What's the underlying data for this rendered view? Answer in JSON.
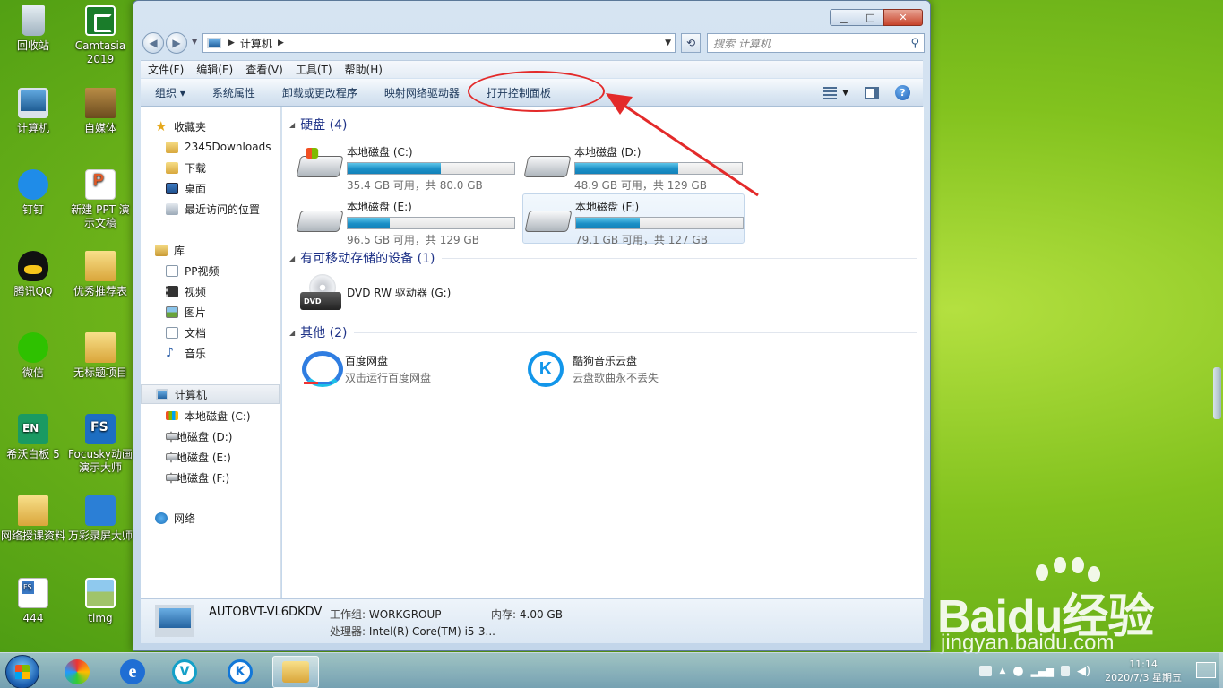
{
  "desktop": {
    "icons": [
      {
        "label": "回收站",
        "icon": "recycle-bin-icon"
      },
      {
        "label": "Camtasia 2019",
        "icon": "camtasia-icon"
      },
      {
        "label": "计算机",
        "icon": "computer-icon"
      },
      {
        "label": "自媒体",
        "icon": "folder-icon"
      },
      {
        "label": "钉钉",
        "icon": "dingtalk-icon"
      },
      {
        "label": "新建 PPT 演示文稿",
        "icon": "ppt-file-icon"
      },
      {
        "label": "腾讯QQ",
        "icon": "qq-icon"
      },
      {
        "label": "优秀推荐表",
        "icon": "folder-icon"
      },
      {
        "label": "微信",
        "icon": "wechat-icon"
      },
      {
        "label": "无标题项目",
        "icon": "folder-icon"
      },
      {
        "label": "希沃白板 5",
        "icon": "seewo-icon"
      },
      {
        "label": "Focusky动画演示大师",
        "icon": "focusky-icon"
      },
      {
        "label": "网络授课资料",
        "icon": "folder-icon"
      },
      {
        "label": "万彩录屏大师",
        "icon": "wancai-icon"
      },
      {
        "label": "444",
        "icon": "document-icon"
      },
      {
        "label": "timg",
        "icon": "image-file-icon"
      }
    ]
  },
  "window": {
    "address": {
      "crumb": "计算机"
    },
    "search_placeholder": "搜索 计算机",
    "menu": [
      "文件(F)",
      "编辑(E)",
      "查看(V)",
      "工具(T)",
      "帮助(H)"
    ],
    "toolbar": [
      "组织 ▾",
      "系统属性",
      "卸载或更改程序",
      "映射网络驱动器",
      "打开控制面板"
    ],
    "nav": {
      "favorites": "收藏夹",
      "fav_items": [
        "2345Downloads",
        "下载",
        "桌面",
        "最近访问的位置"
      ],
      "libraries": "库",
      "lib_items": [
        "PP视频",
        "视频",
        "图片",
        "文档",
        "音乐"
      ],
      "computer": "计算机",
      "drives": [
        "本地磁盘 (C:)",
        "本地磁盘 (D:)",
        "本地磁盘 (E:)",
        "本地磁盘 (F:)"
      ],
      "network": "网络"
    },
    "groups": {
      "hdd": "硬盘 (4)",
      "removable": "有可移动存储的设备 (1)",
      "other": "其他 (2)"
    },
    "drives": [
      {
        "name": "本地磁盘 (C:)",
        "space": "35.4 GB 可用，共 80.0 GB",
        "used_fraction": 0.56
      },
      {
        "name": "本地磁盘 (D:)",
        "space": "48.9 GB 可用，共 129 GB",
        "used_fraction": 0.62
      },
      {
        "name": "本地磁盘 (E:)",
        "space": "96.5 GB 可用，共 129 GB",
        "used_fraction": 0.25
      },
      {
        "name": "本地磁盘 (F:)",
        "space": "79.1 GB 可用，共 127 GB",
        "used_fraction": 0.38
      }
    ],
    "removable": {
      "name": "DVD RW 驱动器 (G:)"
    },
    "other": [
      {
        "name": "百度网盘",
        "desc": "双击运行百度网盘"
      },
      {
        "name": "酷狗音乐云盘",
        "desc": "云盘歌曲永不丢失"
      }
    ],
    "details": {
      "computer_name": "AUTOBVT-VL6DKDV",
      "workgroup_label": "工作组:",
      "workgroup": "WORKGROUP",
      "memory_label": "内存:",
      "memory": "4.00 GB",
      "cpu_label": "处理器:",
      "cpu": "Intel(R) Core(TM) i5-3..."
    }
  },
  "taskbar": {
    "time": "11:14",
    "date": "2020/7/3 星期五"
  },
  "watermark": {
    "brand": "Baidu经验",
    "url": "jingyan.baidu.com"
  },
  "colors": {
    "annotation": "#e32a2a",
    "drive_bar": "#1b8fc6",
    "group_header": "#1e3287"
  }
}
